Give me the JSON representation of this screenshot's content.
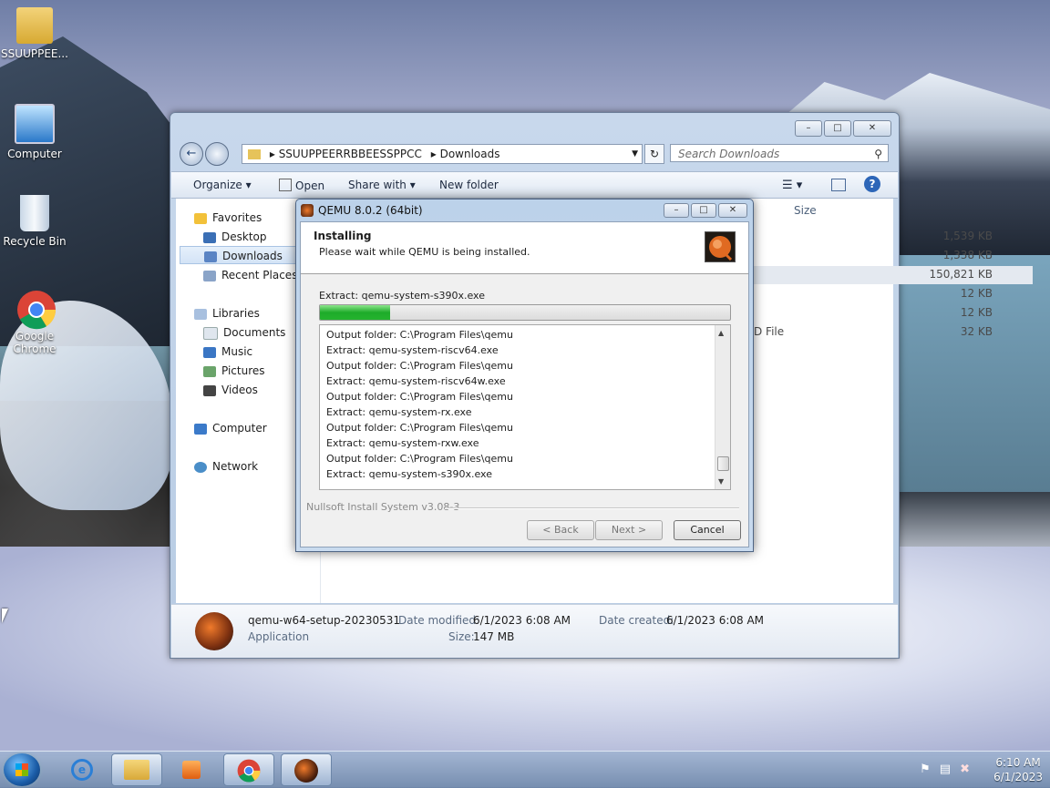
{
  "desktop": {
    "icons": [
      {
        "label": "SSUUPPEE...",
        "icon": "user-folder-icon"
      },
      {
        "label": "Computer",
        "icon": "computer-icon"
      },
      {
        "label": "Recycle Bin",
        "icon": "recycle-bin-icon"
      },
      {
        "label": "Google Chrome",
        "icon": "chrome-icon"
      }
    ]
  },
  "explorer": {
    "breadcrumb": [
      "SSUUPPEERRBBEESSPPCC",
      "Downloads"
    ],
    "search_placeholder": "Search Downloads",
    "toolbar": {
      "organize": "Organize",
      "open": "Open",
      "share_with": "Share with",
      "new_folder": "New folder"
    },
    "nav": {
      "favorites": "Favorites",
      "desktop": "Desktop",
      "downloads": "Downloads",
      "recent": "Recent Places",
      "libraries": "Libraries",
      "documents": "Documents",
      "music": "Music",
      "pictures": "Pictures",
      "videos": "Videos",
      "computer": "Computer",
      "network": "Network"
    },
    "columns": {
      "size": "Size"
    },
    "file_sizes": [
      "1,539 KB",
      "1,338 KB",
      "150,821 KB",
      "12 KB",
      "12 KB",
      "32 KB"
    ],
    "partial_type": "D File",
    "details": {
      "name": "qemu-w64-setup-20230531",
      "type": "Application",
      "date_modified_label": "Date modified:",
      "date_modified": "6/1/2023 6:08 AM",
      "date_created_label": "Date created:",
      "date_created": "6/1/2023 6:08 AM",
      "size_label": "Size:",
      "size": "147 MB"
    }
  },
  "qemu": {
    "title": "QEMU 8.0.2 (64bit)",
    "header_title": "Installing",
    "header_sub": "Please wait while QEMU is being installed.",
    "extract_label": "Extract: qemu-system-s390x.exe",
    "progress": 0.17,
    "log": [
      "Output folder: C:\\Program Files\\qemu",
      "Extract: qemu-system-riscv64.exe",
      "Output folder: C:\\Program Files\\qemu",
      "Extract: qemu-system-riscv64w.exe",
      "Output folder: C:\\Program Files\\qemu",
      "Extract: qemu-system-rx.exe",
      "Output folder: C:\\Program Files\\qemu",
      "Extract: qemu-system-rxw.exe",
      "Output folder: C:\\Program Files\\qemu",
      "Extract: qemu-system-s390x.exe"
    ],
    "nsis": "Nullsoft Install System v3.08-3",
    "buttons": {
      "back": "< Back",
      "next": "Next >",
      "cancel": "Cancel"
    }
  },
  "taskbar": {
    "apps": [
      "internet-explorer-icon",
      "explorer-icon",
      "media-player-icon",
      "chrome-icon",
      "qemu-icon"
    ],
    "time": "6:10 AM",
    "date": "6/1/2023"
  }
}
